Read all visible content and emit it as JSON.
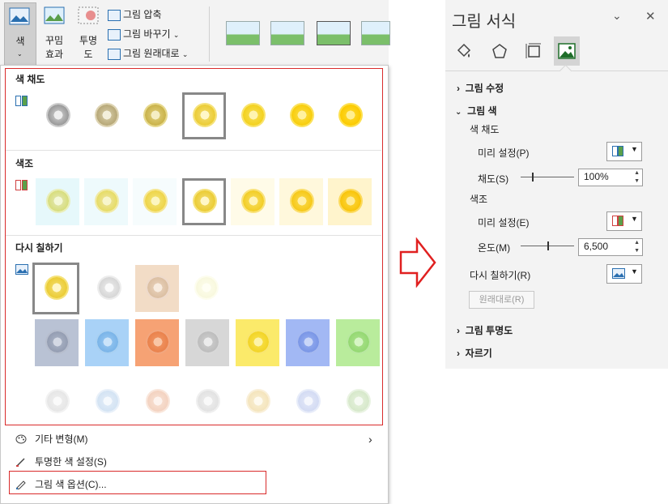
{
  "ribbon": {
    "color_label": "색",
    "artistic_label_1": "꾸밈",
    "artistic_label_2": "효과",
    "transparency_label_1": "투명",
    "transparency_label_2": "도",
    "compress_label": "그림 압축",
    "change_label": "그림 바꾸기",
    "reset_label": "그림 원래대로"
  },
  "dropdown": {
    "saturation_title": "색 채도",
    "tone_title": "색조",
    "recolor_title": "다시 칠하기",
    "more_variations": "기타 변형(M)",
    "set_transparent": "투명한 색 설정(S)",
    "color_options": "그림 색 옵션(C)..."
  },
  "colors": {
    "accent_red": "#d92b2b",
    "selected_outline": "#888888",
    "pane_bg": "#f3f3f3",
    "icon_blue": "#2a6fb0"
  },
  "pane": {
    "title": "그림 서식",
    "sections": {
      "correction": "그림 수정",
      "color": "그림 색",
      "transparency": "그림 투명도",
      "crop": "자르기"
    },
    "saturation_title": "색 채도",
    "saturation_preset_label": "미리 설정(P)",
    "saturation_label": "채도(S)",
    "saturation_value": "100%",
    "tone_title": "색조",
    "tone_preset_label": "미리 설정(E)",
    "temperature_label": "온도(M)",
    "temperature_value": "6,500",
    "recolor_label": "다시 칠하기(R)",
    "reset_button": "원래대로(R)"
  }
}
